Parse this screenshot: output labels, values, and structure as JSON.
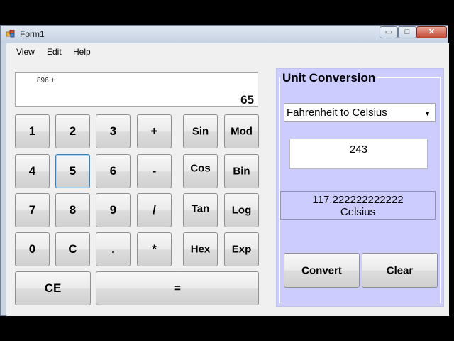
{
  "window": {
    "title": "Form1"
  },
  "titlebar_controls": {
    "minimize": "▭",
    "maximize": "□",
    "close": "✕"
  },
  "menu": [
    "View",
    "Edit",
    "Help"
  ],
  "display": {
    "expression": "896 +",
    "result": "65"
  },
  "keypad": [
    {
      "label": "1",
      "name": "digit-1-button"
    },
    {
      "label": "2",
      "name": "digit-2-button"
    },
    {
      "label": "3",
      "name": "digit-3-button"
    },
    {
      "label": "+",
      "name": "add-button"
    },
    {
      "label": "4",
      "name": "digit-4-button"
    },
    {
      "label": "5",
      "name": "digit-5-button"
    },
    {
      "label": "6",
      "name": "digit-6-button"
    },
    {
      "label": "-",
      "name": "subtract-button"
    },
    {
      "label": "7",
      "name": "digit-7-button"
    },
    {
      "label": "8",
      "name": "digit-8-button"
    },
    {
      "label": "9",
      "name": "digit-9-button"
    },
    {
      "label": "/",
      "name": "divide-button"
    },
    {
      "label": "0",
      "name": "digit-0-button"
    },
    {
      "label": "C",
      "name": "clear-button"
    },
    {
      "label": ".",
      "name": "decimal-button"
    },
    {
      "label": "*",
      "name": "multiply-button"
    },
    {
      "label": "CE",
      "name": "clear-entry-button"
    },
    {
      "label": "=",
      "name": "equals-button"
    }
  ],
  "functions": [
    {
      "label": "Sin",
      "name": "sin-button"
    },
    {
      "label": "Mod",
      "name": "mod-button"
    },
    {
      "label": "Cos",
      "name": "cos-button"
    },
    {
      "label": "Bin",
      "name": "bin-button"
    },
    {
      "label": "Tan",
      "name": "tan-button"
    },
    {
      "label": "Log",
      "name": "log-button"
    },
    {
      "label": "Hex",
      "name": "hex-button"
    },
    {
      "label": "Exp",
      "name": "exp-button"
    }
  ],
  "unit_conversion": {
    "title": "Unit Conversion",
    "selected_conversion": "Fahrenheit to Celsius",
    "input_value": "243",
    "result_value": "117.222222222222",
    "result_unit": "Celsius",
    "convert_label": "Convert",
    "clear_label": "Clear"
  }
}
